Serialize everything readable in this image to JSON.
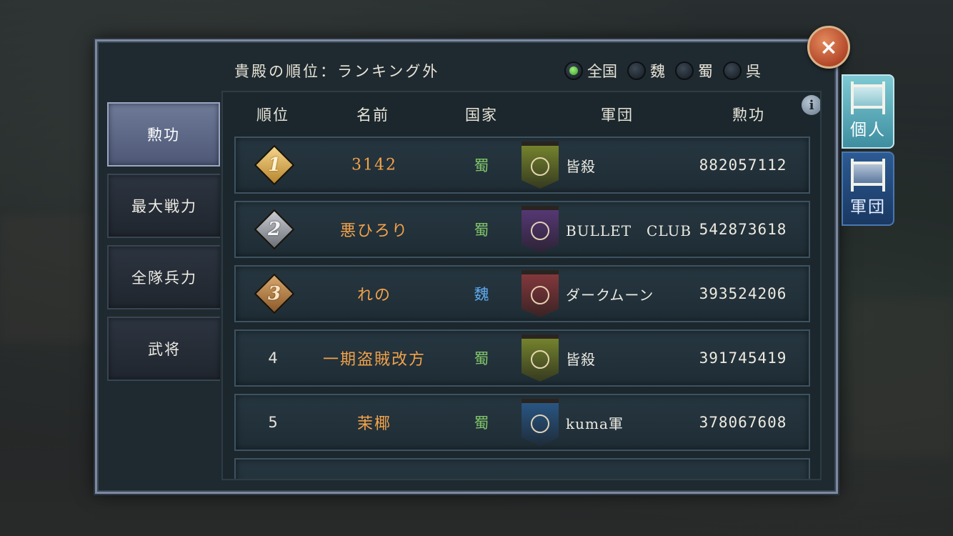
{
  "header": {
    "rank_text": "貴殿の順位：ランキング外",
    "close_label": "×"
  },
  "region_filter": {
    "selected": "全国",
    "options": [
      "全国",
      "魏",
      "蜀",
      "呉"
    ]
  },
  "side_tabs": [
    {
      "label": "勲功",
      "active": true
    },
    {
      "label": "最大戦力",
      "active": false
    },
    {
      "label": "全隊兵力",
      "active": false
    },
    {
      "label": "武将",
      "active": false
    }
  ],
  "right_tabs": [
    {
      "label": "個人",
      "active": true
    },
    {
      "label": "軍団",
      "active": false
    }
  ],
  "table": {
    "columns": [
      "順位",
      "名前",
      "国家",
      "軍団",
      "勲功"
    ],
    "info_label": "i",
    "rows": [
      {
        "rank": "1",
        "medal": "gold",
        "name": "3142",
        "country": "蜀",
        "country_color": "#7fc268",
        "guild": "皆殺",
        "banner_color": "#7a8a2e",
        "merit": "882057112"
      },
      {
        "rank": "2",
        "medal": "silver",
        "name": "悪ひろり",
        "country": "蜀",
        "country_color": "#7fc268",
        "guild": "BULLET　CLUB",
        "banner_color": "#5a3a7a",
        "merit": "542873618"
      },
      {
        "rank": "3",
        "medal": "bronze",
        "name": "れの",
        "country": "魏",
        "country_color": "#5eaaf0",
        "guild": "ダークムーン",
        "banner_color": "#8a3a3e",
        "merit": "393524206"
      },
      {
        "rank": "4",
        "medal": "",
        "name": "一期盗賊改方",
        "country": "蜀",
        "country_color": "#7fc268",
        "guild": "皆殺",
        "banner_color": "#7a8a2e",
        "merit": "391745419"
      },
      {
        "rank": "5",
        "medal": "",
        "name": "茉椰",
        "country": "蜀",
        "country_color": "#7fc268",
        "guild": "kuma軍",
        "banner_color": "#2a5a8a",
        "merit": "378067608"
      }
    ]
  },
  "colors": {
    "name_text": "#f2a24a",
    "shu": "#7fc268",
    "wei": "#5eaaf0"
  }
}
